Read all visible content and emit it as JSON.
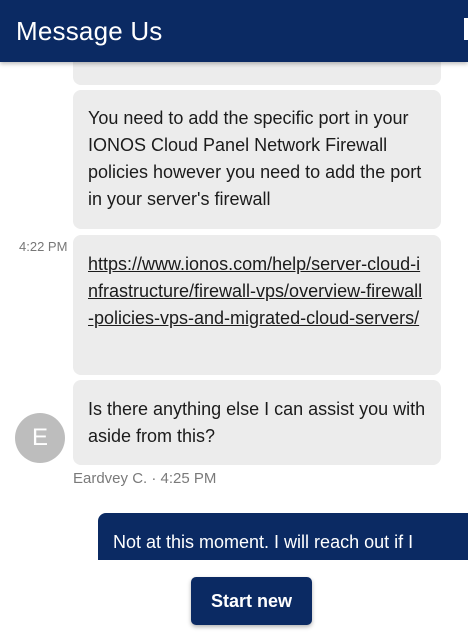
{
  "header": {
    "title": "Message Us"
  },
  "messages": [
    {
      "sender": "agent",
      "text": "You need to add the specific port in your IONOS Cloud Panel Network Firewall policies however you need to add the port in your server's firewall"
    },
    {
      "sender": "agent",
      "time": "4:22 PM",
      "link": "https://www.ionos.com/help/server-cloud-infrastructure/firewall-vps/overview-firewall-policies-vps-and-migrated-cloud-servers/"
    },
    {
      "sender": "agent",
      "text": "Is there anything else I can assist you with aside from this?"
    },
    {
      "sender": "user",
      "text": "Not at this moment. I will reach out if I"
    }
  ],
  "agent": {
    "avatar_letter": "E",
    "meta": "Eardvey C. · 4:25 PM"
  },
  "footer": {
    "start_new_label": "Start new"
  },
  "colors": {
    "brand": "#0b2a63",
    "bubble": "#ececec"
  }
}
